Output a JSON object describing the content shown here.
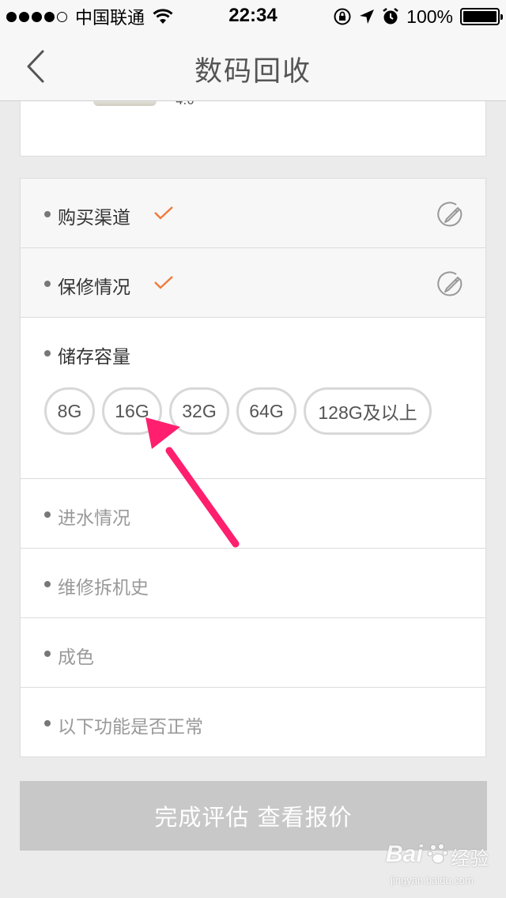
{
  "status_bar": {
    "carrier": "中国联通",
    "time": "22:34",
    "battery": "100%",
    "battery_level": 1.0,
    "signal_bars_filled": 4,
    "signal_bars_total": 5,
    "icons": [
      "wifi-icon",
      "rotation-lock-icon",
      "location-arrow-icon",
      "alarm-icon",
      "battery-icon"
    ]
  },
  "nav": {
    "title": "数码回收",
    "back_icon": "chevron-left-icon"
  },
  "top_card": {
    "partial_text": "4.0"
  },
  "sections": {
    "purchase_channel": {
      "label": "购买渠道",
      "status": "done"
    },
    "warranty": {
      "label": "保修情况",
      "status": "done"
    },
    "storage": {
      "label": "储存容量",
      "options": [
        "8G",
        "16G",
        "32G",
        "64G",
        "128G及以上"
      ]
    },
    "water_damage": {
      "label": "进水情况",
      "status": "pending"
    },
    "repair_history": {
      "label": "维修拆机史",
      "status": "pending"
    },
    "condition": {
      "label": "成色",
      "status": "pending"
    },
    "functions": {
      "label": "以下功能是否正常",
      "status": "pending"
    }
  },
  "submit": {
    "label": "完成评估 查看报价"
  },
  "watermark": {
    "brand": "Bai",
    "brand_cn": "经验",
    "url": "jingyan.baidu.com"
  },
  "colors": {
    "accent_check": "#f07a3a",
    "annotation_arrow": "#ff1f6e",
    "submit_disabled": "#c8c8c8"
  }
}
